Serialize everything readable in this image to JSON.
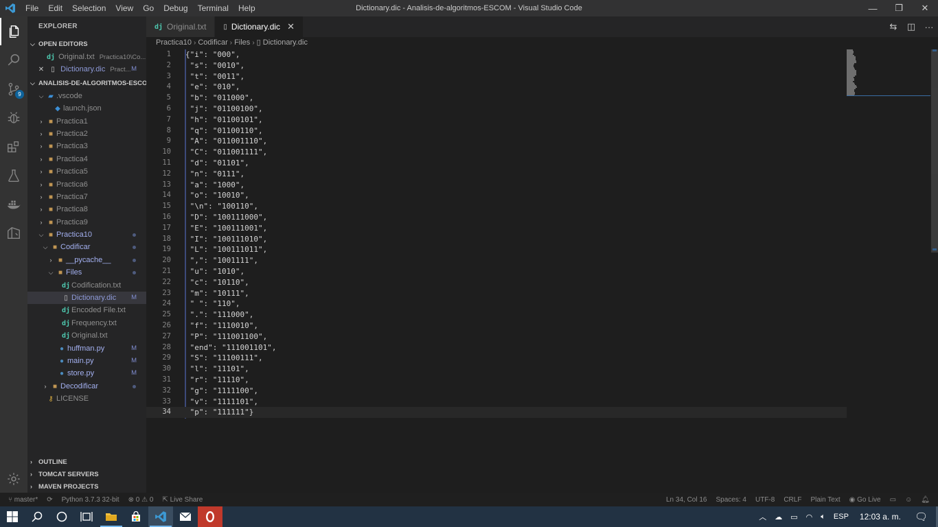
{
  "window": {
    "title": "Dictionary.dic - Analisis-de-algoritmos-ESCOM - Visual Studio Code",
    "menu": [
      "File",
      "Edit",
      "Selection",
      "View",
      "Go",
      "Debug",
      "Terminal",
      "Help"
    ],
    "controls": {
      "minimize": "—",
      "restore": "❐",
      "close": "✕"
    }
  },
  "activity_bar": {
    "items": [
      "explorer-icon",
      "search-icon",
      "source-control-icon",
      "debug-icon",
      "extensions-icon",
      "test-icon",
      "docker-icon",
      "remote-icon"
    ],
    "scm_badge": "9",
    "bottom": "gear-icon"
  },
  "sidebar": {
    "title": "EXPLORER",
    "open_editors": {
      "header": "OPEN EDITORS",
      "items": [
        {
          "icon": "dj",
          "label": "Original.txt",
          "desc": "Practica10\\Co..."
        },
        {
          "close": "✕",
          "label": "Dictionary.dic",
          "desc": "Pract...",
          "mark": "M"
        }
      ]
    },
    "workspace": {
      "header": "ANALISIS-DE-ALGORITMOS-ESCOM",
      "items": [
        {
          "label": ".vscode"
        },
        {
          "label": "launch.json"
        },
        {
          "label": "Practica1"
        },
        {
          "label": "Practica2"
        },
        {
          "label": "Practica3"
        },
        {
          "label": "Practica4"
        },
        {
          "label": "Practica5"
        },
        {
          "label": "Practica6"
        },
        {
          "label": "Practica7"
        },
        {
          "label": "Practica8"
        },
        {
          "label": "Practica9"
        },
        {
          "label": "Practica10"
        },
        {
          "label": "Codificar"
        },
        {
          "label": "__pycache__"
        },
        {
          "label": "Files"
        },
        {
          "label": "Codification.txt"
        },
        {
          "label": "Dictionary.dic",
          "mark": "M"
        },
        {
          "label": "Encoded File.txt"
        },
        {
          "label": "Frequency.txt"
        },
        {
          "label": "Original.txt"
        },
        {
          "label": "huffman.py",
          "mark": "M"
        },
        {
          "label": "main.py",
          "mark": "M"
        },
        {
          "label": "store.py",
          "mark": "M"
        },
        {
          "label": "Decodificar"
        },
        {
          "label": "LICENSE"
        }
      ]
    },
    "bottom_sections": [
      "OUTLINE",
      "TOMCAT SERVERS",
      "MAVEN PROJECTS"
    ]
  },
  "editor": {
    "tabs": [
      {
        "icon": "dj",
        "label": "Original.txt"
      },
      {
        "label": "Dictionary.dic",
        "close": "✕"
      }
    ],
    "breadcrumb": [
      "Practica10",
      "Codificar",
      "Files",
      "Dictionary.dic"
    ],
    "lines": [
      {
        "n": "1",
        "text": "{\"i\": \"000\","
      },
      {
        "n": "2",
        "text": " \"s\": \"0010\","
      },
      {
        "n": "3",
        "text": " \"t\": \"0011\","
      },
      {
        "n": "4",
        "text": " \"e\": \"010\","
      },
      {
        "n": "5",
        "text": " \"b\": \"011000\","
      },
      {
        "n": "6",
        "text": " \"j\": \"01100100\","
      },
      {
        "n": "7",
        "text": " \"h\": \"01100101\","
      },
      {
        "n": "8",
        "text": " \"q\": \"01100110\","
      },
      {
        "n": "9",
        "text": " \"A\": \"011001110\","
      },
      {
        "n": "10",
        "text": " \"C\": \"011001111\","
      },
      {
        "n": "11",
        "text": " \"d\": \"01101\","
      },
      {
        "n": "12",
        "text": " \"n\": \"0111\","
      },
      {
        "n": "13",
        "text": " \"a\": \"1000\","
      },
      {
        "n": "14",
        "text": " \"o\": \"10010\","
      },
      {
        "n": "15",
        "text": " \"\\n\": \"100110\","
      },
      {
        "n": "16",
        "text": " \"D\": \"100111000\","
      },
      {
        "n": "17",
        "text": " \"E\": \"100111001\","
      },
      {
        "n": "18",
        "text": " \"I\": \"100111010\","
      },
      {
        "n": "19",
        "text": " \"L\": \"100111011\","
      },
      {
        "n": "20",
        "text": " \",\": \"1001111\","
      },
      {
        "n": "21",
        "text": " \"u\": \"1010\","
      },
      {
        "n": "22",
        "text": " \"c\": \"10110\","
      },
      {
        "n": "23",
        "text": " \"m\": \"10111\","
      },
      {
        "n": "24",
        "text": " \" \": \"110\","
      },
      {
        "n": "25",
        "text": " \".\": \"111000\","
      },
      {
        "n": "26",
        "text": " \"f\": \"1110010\","
      },
      {
        "n": "27",
        "text": " \"P\": \"111001100\","
      },
      {
        "n": "28",
        "text": " \"end\": \"111001101\","
      },
      {
        "n": "29",
        "text": " \"S\": \"11100111\","
      },
      {
        "n": "30",
        "text": " \"l\": \"11101\","
      },
      {
        "n": "31",
        "text": " \"r\": \"11110\","
      },
      {
        "n": "32",
        "text": " \"g\": \"1111100\","
      },
      {
        "n": "33",
        "text": " \"v\": \"1111101\","
      },
      {
        "n": "34",
        "text": " \"p\": \"111111\"}"
      }
    ],
    "current_line": "34"
  },
  "status_bar": {
    "branch": "master*",
    "python": "Python 3.7.3 32-bit",
    "problems": "⊗ 0 ⚠ 0",
    "live_share": "Live Share",
    "position": "Ln 34, Col 16",
    "spaces": "Spaces: 4",
    "encoding": "UTF-8",
    "eol": "CRLF",
    "language": "Plain Text",
    "go_live": "Go Live"
  },
  "taskbar": {
    "language": "ESP",
    "time": "12:03 a. m."
  }
}
